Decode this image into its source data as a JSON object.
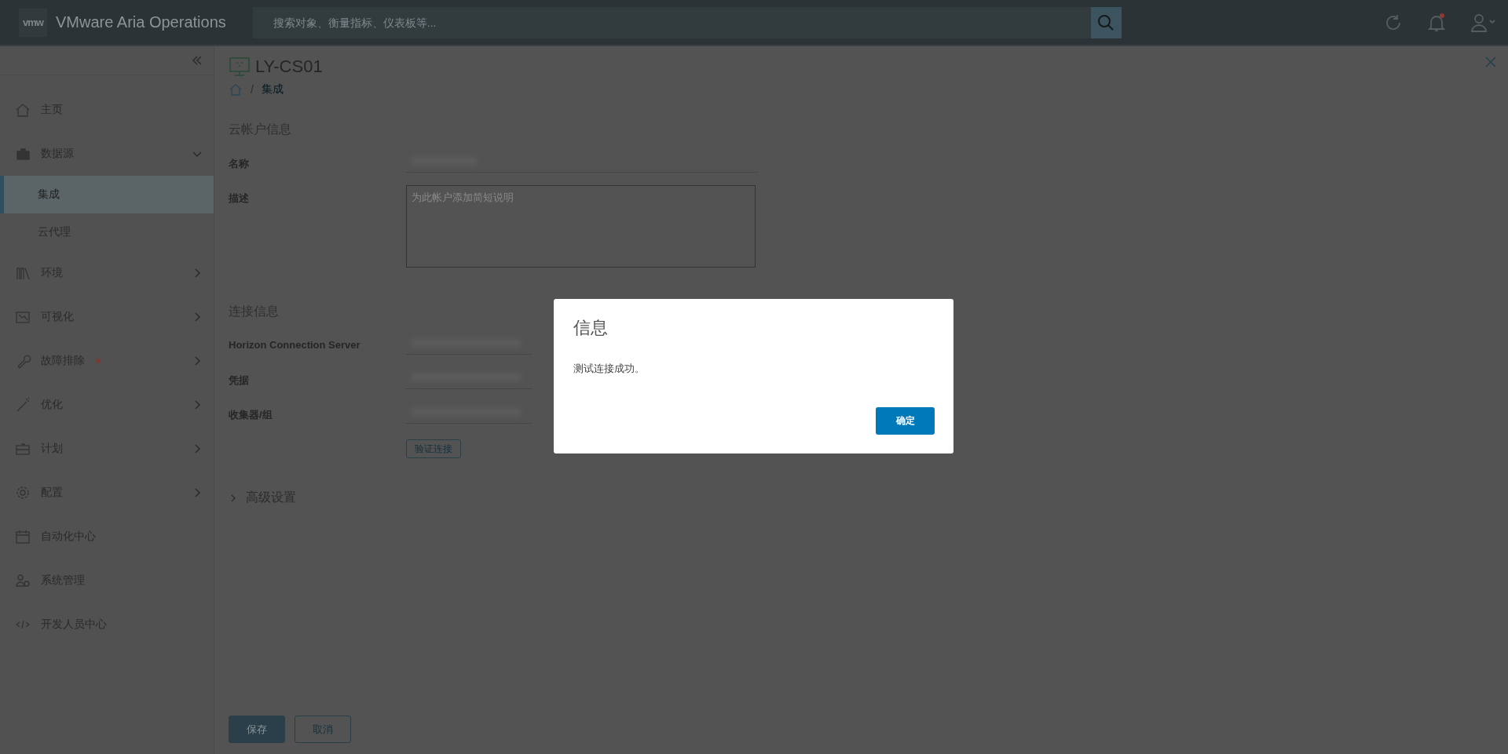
{
  "header": {
    "logo": "vmw",
    "product": "VMware Aria Operations",
    "search": {
      "placeholder": "搜索对象、衡量指标、仪表板等..."
    },
    "notifications": {
      "unread": true
    }
  },
  "sidebar": {
    "items": [
      {
        "label": "主页",
        "kind": "link",
        "selected": false,
        "alert": false
      },
      {
        "label": "数据源",
        "kind": "group",
        "expanded": true,
        "selected": false,
        "alert": false
      },
      {
        "label": "集成",
        "kind": "sub",
        "selected": true,
        "alert": false
      },
      {
        "label": "云代理",
        "kind": "sub",
        "selected": false,
        "alert": false
      },
      {
        "label": "环境",
        "kind": "group",
        "expanded": false,
        "selected": false,
        "alert": false
      },
      {
        "label": "可视化",
        "kind": "group",
        "expanded": false,
        "selected": false,
        "alert": false
      },
      {
        "label": "故障排除",
        "kind": "group",
        "expanded": false,
        "selected": false,
        "alert": true
      },
      {
        "label": "优化",
        "kind": "group",
        "expanded": false,
        "selected": false,
        "alert": false
      },
      {
        "label": "计划",
        "kind": "group",
        "expanded": false,
        "selected": false,
        "alert": false
      },
      {
        "label": "配置",
        "kind": "group",
        "expanded": false,
        "selected": false,
        "alert": false
      },
      {
        "label": "自动化中心",
        "kind": "link",
        "selected": false,
        "alert": false
      },
      {
        "label": "系统管理",
        "kind": "link",
        "selected": false,
        "alert": false
      },
      {
        "label": "开发人员中心",
        "kind": "link",
        "selected": false,
        "alert": false
      }
    ]
  },
  "page": {
    "title": "LY-CS01",
    "breadcrumb_separator": "/",
    "breadcrumb": [
      "集成"
    ],
    "sections": [
      {
        "title": "云帐户信息",
        "fields": [
          {
            "label": "名称",
            "kind": "text"
          },
          {
            "label": "描述",
            "kind": "textarea",
            "placeholder": "为此帐户添加简短说明"
          }
        ]
      },
      {
        "title": "连接信息",
        "fields": [
          {
            "label": "Horizon Connection Server",
            "kind": "text"
          },
          {
            "label": "凭据",
            "kind": "select"
          },
          {
            "label": "收集器/组",
            "kind": "select"
          }
        ],
        "action": "验证连接"
      }
    ],
    "advanced": {
      "label": "高级设置",
      "expanded": false
    },
    "buttons": [
      {
        "label": "保存",
        "kind": "primary"
      },
      {
        "label": "取消",
        "kind": "outline"
      }
    ]
  },
  "dialog": {
    "title": "信息",
    "message": "测试连接成功。",
    "button": "确定"
  }
}
